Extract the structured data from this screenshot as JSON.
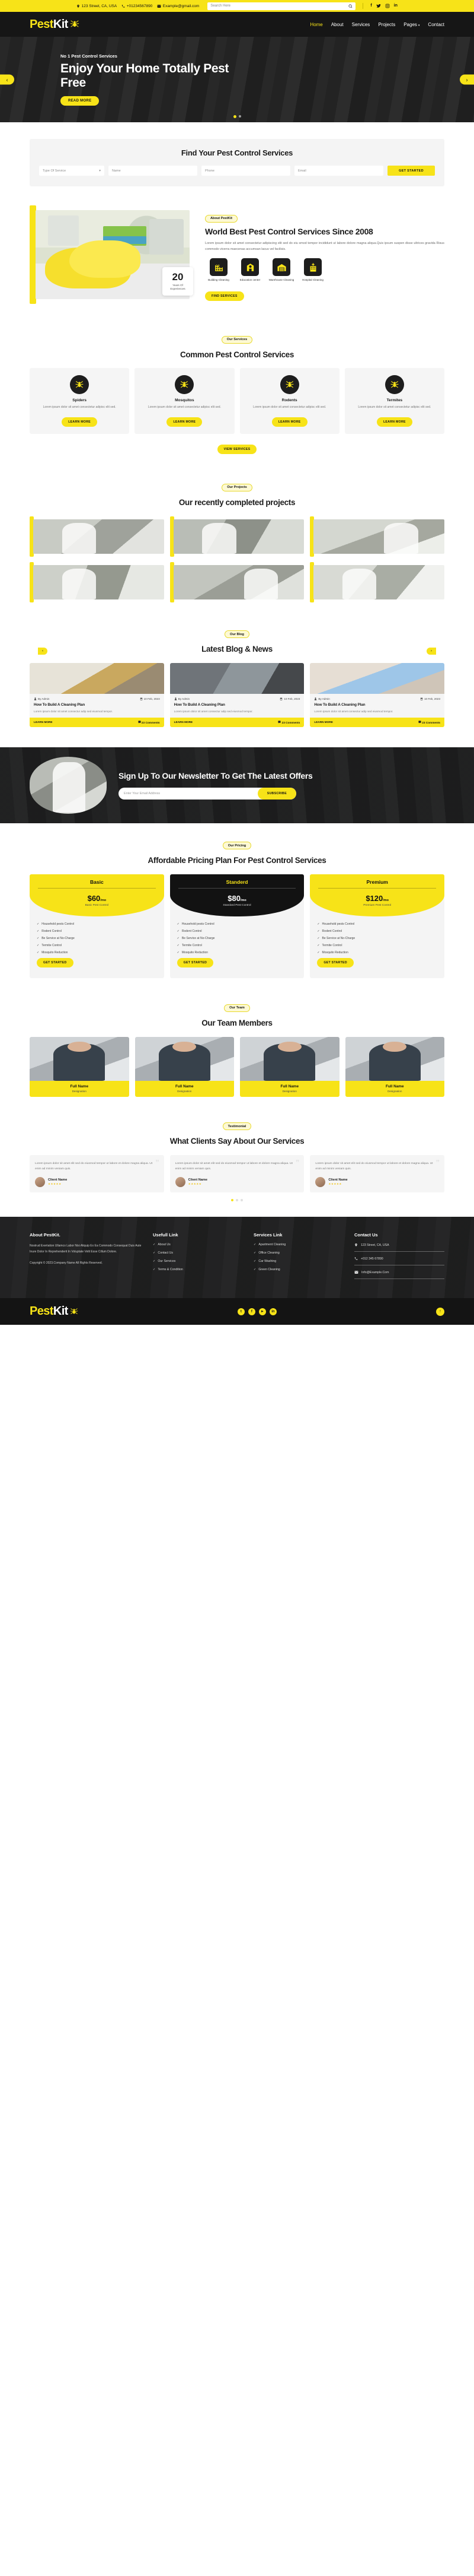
{
  "topbar": {
    "address": "123 Street, CA, USA",
    "phone": "+01234567890",
    "email": "Example@gmail.com",
    "search_placeholder": "Search Here",
    "socials": [
      "f",
      "t",
      "i",
      "in"
    ]
  },
  "nav": {
    "logo_a": "Pest",
    "logo_b": "Kit",
    "items": [
      {
        "label": "Home",
        "active": true
      },
      {
        "label": "About",
        "active": false
      },
      {
        "label": "Services",
        "active": false
      },
      {
        "label": "Projects",
        "active": false
      },
      {
        "label": "Pages",
        "active": false,
        "caret": "▾"
      },
      {
        "label": "Contact",
        "active": false
      }
    ]
  },
  "hero": {
    "kicker": "No 1 Pest Control Services",
    "title": "Enjoy Your Home Totally Pest Free",
    "cta": "READ MORE",
    "prev": "‹",
    "next": "›"
  },
  "finder": {
    "title": "Find Your Pest Control Services",
    "service_value": "Type Of Service",
    "caret": "▾",
    "name_placeholder": "Name",
    "phone_placeholder": "Phone",
    "email_placeholder": "Email",
    "submit": "GET STARTED"
  },
  "about": {
    "pill": "About PestKit",
    "title": "World Best Pest Control Services Since 2008",
    "body": "Lorem ipsum dolor sit amet consectetur adipiscing elit sed do eiu smod tempor incididunt ut labore dolore magna aliqua.Quis ipsum suspen disse ultrices gravida Risus commodo viverra maecenas accumsan lacus vel facilisis.",
    "badge_number": "20",
    "badge_label": "Years Of Experiences",
    "cta": "FIND SERVICES",
    "services": [
      {
        "icon": "building-icon",
        "label": "Building Cleaning"
      },
      {
        "icon": "education-icon",
        "label": "Education center"
      },
      {
        "icon": "warehouse-icon",
        "label": "Warehouse Cleaning"
      },
      {
        "icon": "hospital-icon",
        "label": "Hospital Cleaning"
      }
    ]
  },
  "services": {
    "pill": "Our Services",
    "title": "Common Pest Control Services",
    "more_label": "VIEW SERVICES",
    "cards": [
      {
        "icon": "spider-icon",
        "title": "Spiders",
        "desc": "Lorem ipsum dolor sit amet consectetur adipisc elit sed.",
        "cta": "LEARN MORE"
      },
      {
        "icon": "mosquito-icon",
        "title": "Mosquitos",
        "desc": "Lorem ipsum dolor sit amet consectetur adipisc elit sed.",
        "cta": "LEARN MORE"
      },
      {
        "icon": "rodent-icon",
        "title": "Rodents",
        "desc": "Lorem ipsum dolor sit amet consectetur adipisc elit sed.",
        "cta": "LEARN MORE"
      },
      {
        "icon": "termite-icon",
        "title": "Termites",
        "desc": "Lorem ipsum dolor sit amet consectetur adipisc elit sed.",
        "cta": "LEARN MORE"
      }
    ]
  },
  "projects": {
    "pill": "Our Projects",
    "title": "Our recently completed projects"
  },
  "blog": {
    "pill": "Our Blog",
    "title": "Latest Blog & News",
    "prev": "‹",
    "next": "›",
    "posts": [
      {
        "author": "By Admin",
        "date": "10 Feb, 2023",
        "title": "How To Build A Cleaning Plan",
        "desc": "Lorem ipsum dolor sit amet consectur adip sed eiusmod tempor.",
        "cta": "LEARN MORE",
        "comments": "23 Comments"
      },
      {
        "author": "By Admin",
        "date": "10 Feb, 2023",
        "title": "How To Build A Cleaning Plan",
        "desc": "Lorem ipsum dolor sit amet consectur adip sed eiusmod tempor.",
        "cta": "LEARN MORE",
        "comments": "23 Comments"
      },
      {
        "author": "By Admin",
        "date": "10 Feb, 2023",
        "title": "How To Build A Cleaning Plan",
        "desc": "Lorem ipsum dolor sit amet consectur adip sed eiusmod tempor.",
        "cta": "LEARN MORE",
        "comments": "23 Comments"
      }
    ]
  },
  "newsletter": {
    "title": "Sign Up To Our Newsletter To Get The Latest Offers",
    "placeholder": "Enter Your Email Address",
    "button": "SUBSCRIBE"
  },
  "pricing": {
    "pill": "Our Pricing",
    "title": "Affordable Pricing Plan For Pest Control Services",
    "plans": [
      {
        "name": "Basic",
        "price": "$60",
        "per": "/mo",
        "sub": "Basic Pest Control",
        "featured": false,
        "features": [
          "Household pests Control",
          "Rodent Control",
          "Be Service at No-Charge",
          "Termite Control",
          "Mosquito Reduction"
        ],
        "cta": "GET STARTED"
      },
      {
        "name": "Standerd",
        "price": "$80",
        "per": "/mo",
        "sub": "Standard Pest Control",
        "featured": true,
        "features": [
          "Household pests Control",
          "Rodent Control",
          "Be Service at No-Charge",
          "Termite Control",
          "Mosquito Reduction"
        ],
        "cta": "GET STARTED"
      },
      {
        "name": "Premium",
        "price": "$120",
        "per": "/mo",
        "sub": "Premium Pest Control",
        "featured": false,
        "features": [
          "Household pests Control",
          "Rodent Control",
          "Be Service at No-Charge",
          "Termite Control",
          "Mosquito Reduction"
        ],
        "cta": "GET STARTED"
      }
    ]
  },
  "team": {
    "pill": "Our Team",
    "title": "Our Team Members",
    "members": [
      {
        "name": "Full Name",
        "role": "Designation"
      },
      {
        "name": "Full Name",
        "role": "Designation"
      },
      {
        "name": "Full Name",
        "role": "Designation"
      },
      {
        "name": "Full Name",
        "role": "Designation"
      }
    ]
  },
  "testimonial": {
    "pill": "Testimonial",
    "title": "What Clients Say About Our Services",
    "items": [
      {
        "quote": "Lorem ipsum dolor sit amet elit sed do eiusmod tempor ut labore et dolore magna aliqua. Ut enim ad minim veniam quis.",
        "name": "Client Name",
        "role": "Profession",
        "stars": "★★★★★"
      },
      {
        "quote": "Lorem ipsum dolor sit amet elit sed do eiusmod tempor ut labore et dolore magna aliqua. Ut enim ad minim veniam quis.",
        "name": "Client Name",
        "role": "Profession",
        "stars": "★★★★★"
      },
      {
        "quote": "Lorem ipsum dolor sit amet elit sed do eiusmod tempor ut labore et dolore magna aliqua. Ut enim ad minim veniam quis.",
        "name": "Client Name",
        "role": "Profession",
        "stars": "★★★★★"
      }
    ]
  },
  "footer": {
    "about_title": "About PestKit.",
    "about_body": "Nostrud Exertation Ullamco Labor Nisi Aliquip Ex Ea Commodo Consequat Duis Aute Inure Dolor In Reprehenderit In Voluptate Velit Esse Cillum Dolore.",
    "copyright": "Copyright © 2023.Company Name All Rights Reserved.",
    "useful_title": "Usefull Link",
    "useful_links": [
      "About Us",
      "Contact Us",
      "Our Services",
      "Terms & Condition"
    ],
    "services_title": "Services Link",
    "services_links": [
      "Apartment Cleaning",
      "Office Cleaning",
      "Car Washing",
      "Green Cleaning"
    ],
    "contact_title": "Contact Us",
    "contact": [
      {
        "icon": "location-icon",
        "text": "123 Street, CA, USA"
      },
      {
        "icon": "phone-icon",
        "text": "+012 345 67890"
      },
      {
        "icon": "mail-icon",
        "text": "Info@Example.Com"
      }
    ],
    "logo_a": "Pest",
    "logo_b": "Kit",
    "socials": [
      "t",
      "f",
      "y",
      "in"
    ],
    "to_top": "↑"
  },
  "colors": {
    "accent": "#f7e318",
    "dark": "#161616",
    "muted": "#f4f4f4"
  }
}
